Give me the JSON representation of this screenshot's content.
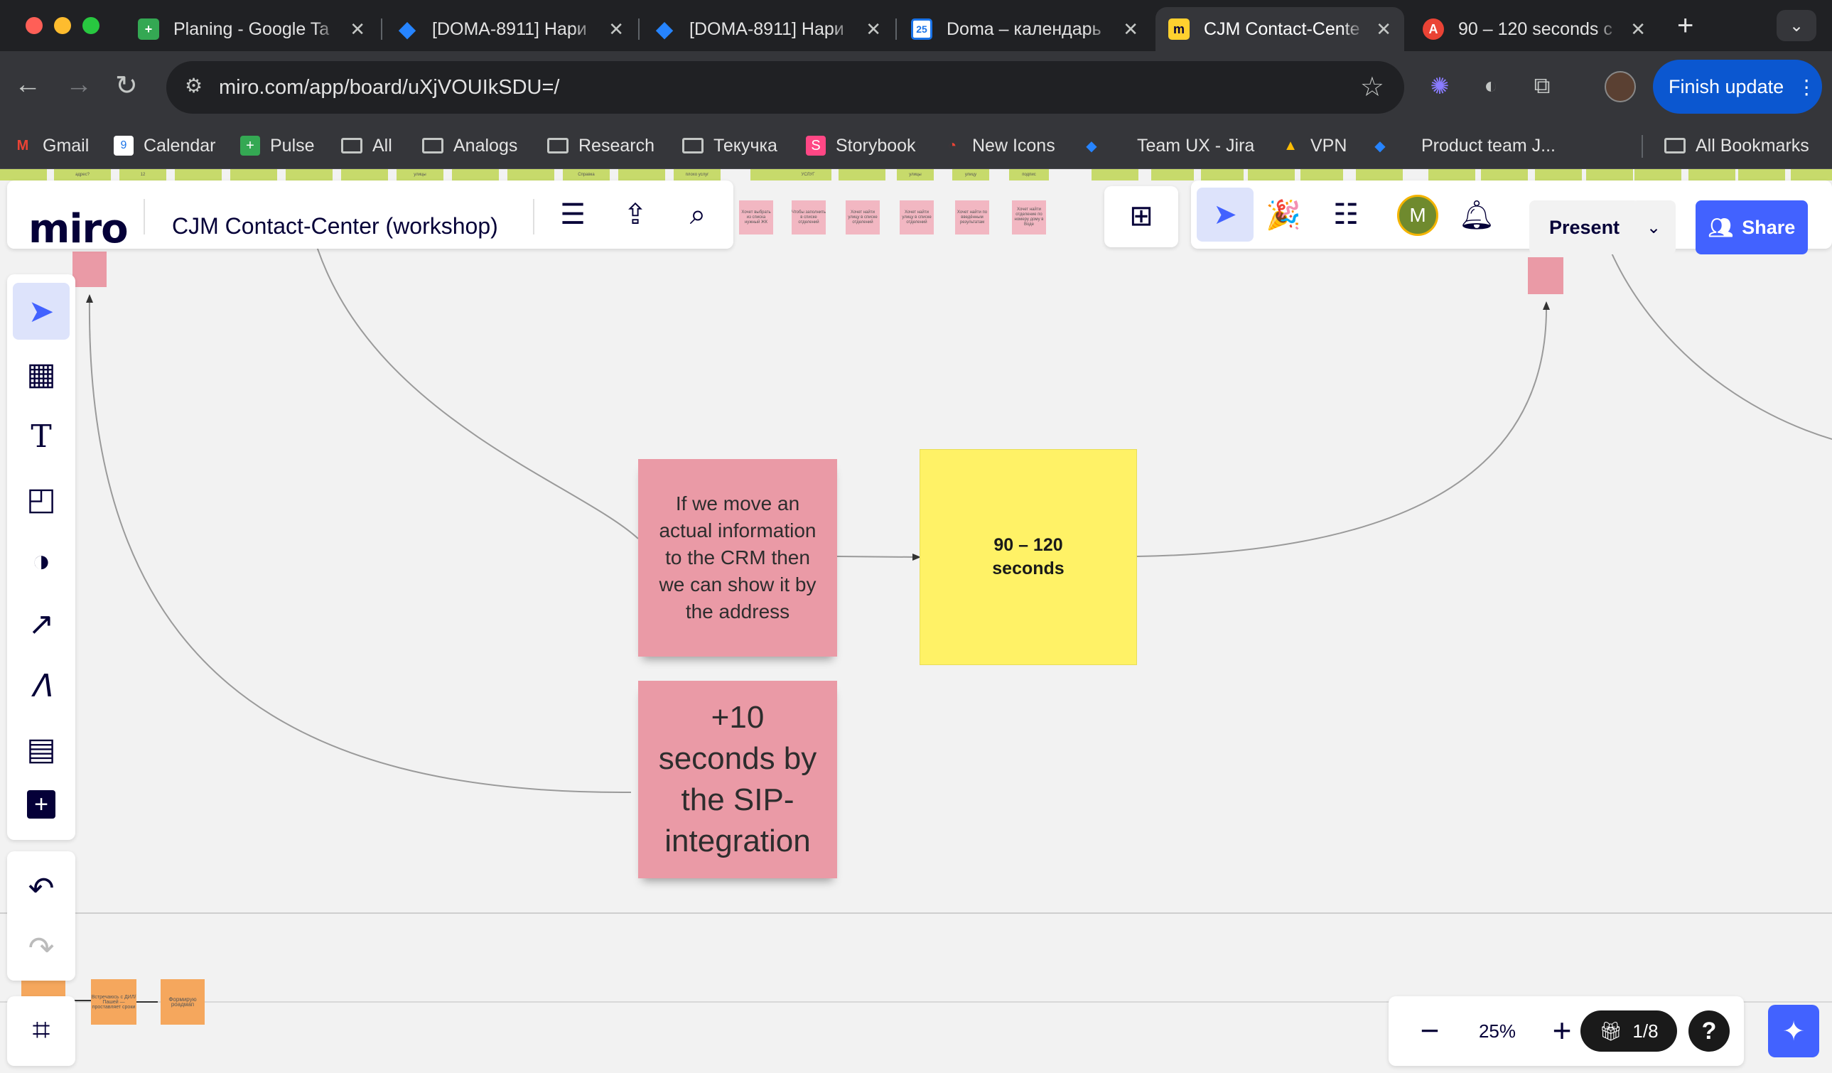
{
  "browser": {
    "tabs": [
      {
        "title": "Planing - Google Ta",
        "favicon": "google-sheets-icon",
        "color": "#34a853"
      },
      {
        "title": "[DOMA-8911] Нари",
        "favicon": "jira-icon",
        "color": "#2684ff"
      },
      {
        "title": "[DOMA-8911] Нари",
        "favicon": "jira-icon",
        "color": "#2684ff"
      },
      {
        "title": "Doma – календарь",
        "favicon": "google-calendar-icon",
        "color": "#1a73e8",
        "badge": "25"
      },
      {
        "title": "CJM Contact-Cente",
        "favicon": "miro-icon",
        "color": "#ffd02f",
        "active": true
      },
      {
        "title": "90 – 120 seconds c",
        "favicon": "extension-icon",
        "color": "#ea4335"
      }
    ],
    "url": "miro.com/app/board/uXjVOUIkSDU=/",
    "finish_update": "Finish update",
    "bookmarks": [
      {
        "label": "Gmail",
        "icon": "gmail-icon"
      },
      {
        "label": "Calendar",
        "icon": "calendar-icon",
        "badge": "9"
      },
      {
        "label": "Pulse",
        "icon": "sheets-icon"
      },
      {
        "label": "All",
        "icon": "folder-icon"
      },
      {
        "label": "Analogs",
        "icon": "folder-icon"
      },
      {
        "label": "Research",
        "icon": "folder-icon"
      },
      {
        "label": "Текучка",
        "icon": "folder-icon"
      },
      {
        "label": "Storybook",
        "icon": "storybook-icon"
      },
      {
        "label": "New Icons",
        "icon": "icons-icon"
      },
      {
        "label": "Team UX - Jira",
        "icon": "jira-icon"
      },
      {
        "label": "VPN",
        "icon": "drive-icon"
      },
      {
        "label": "Product team J...",
        "icon": "jira-icon"
      }
    ],
    "all_bookmarks": "All Bookmarks"
  },
  "miro": {
    "logo": "miro",
    "board_title": "CJM Contact-Center (workshop)",
    "present_label": "Present",
    "share_label": "Share",
    "user_initial": "M",
    "zoom": "25%",
    "pager": "1/8",
    "help": "?"
  },
  "notes": {
    "pink_main": "If we move an actual information to the CRM then we can show it by the address",
    "yellow": "90 – 120 seconds",
    "pink_bottom": "+10 seconds by the SIP-integration"
  },
  "mini_notes": {
    "top_green": [
      "адрес?",
      "12",
      "улицы",
      "Справка",
      "плохо услуг",
      "УСЛУГ",
      "улицы",
      "улицы",
      "улицу",
      "подпис"
    ],
    "top_pink": [
      "Хочет выбрать из списка нужный ЖК",
      "Чтобы заполнить в списке отделений",
      "Хочет найти улицу в списке отделений",
      "Хочет найти улицу в списке отделений",
      "Хочет найти по введённым результатам",
      "Хочет найти отделение по номеру дому в Воде"
    ],
    "bottom_orange": [
      "Встречаюсь с ДИЛ/Пашей — проставляет сроки",
      "Формирую роадмап"
    ]
  },
  "colors": {
    "pink_note": "#ea9aa6",
    "yellow_note": "#fff266",
    "miro_accent": "#4262ff",
    "orange_note": "#f5a75d"
  }
}
